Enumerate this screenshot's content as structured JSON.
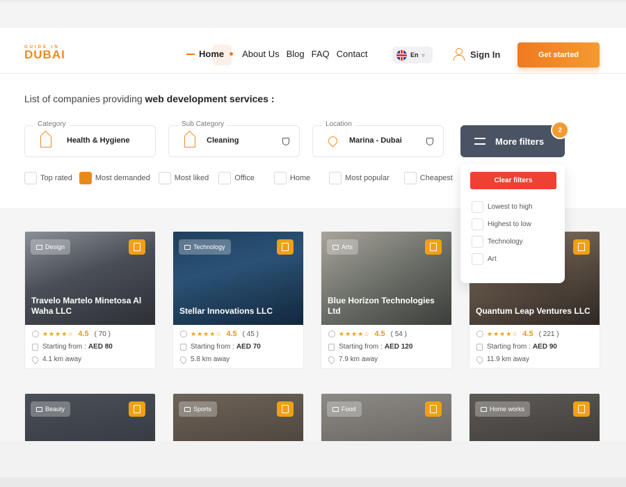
{
  "logo": {
    "small": "GUIDE IN",
    "big": "DUBAI"
  },
  "nav": {
    "home": "Home",
    "about": "About Us",
    "blog": "Blog",
    "faq": "FAQ",
    "contact": "Contact"
  },
  "lang": {
    "code": "En"
  },
  "auth": {
    "sign_in": "Sign In",
    "get_started": "Get started"
  },
  "heading": {
    "prefix": "List of companies providing",
    "service": "web development services :"
  },
  "filters": {
    "category": {
      "label": "Category",
      "value": "Health & Hygiene"
    },
    "sub_category": {
      "label": "Sub Category",
      "value": "Cleaning"
    },
    "location": {
      "label": "Location",
      "value": "Marina - Dubai"
    },
    "more_filters": "More filters",
    "badge_count": "2"
  },
  "checks": [
    {
      "label": "Top rated",
      "checked": false
    },
    {
      "label": "Most demanded",
      "checked": true
    },
    {
      "label": "Most liked",
      "checked": false
    },
    {
      "label": "Office",
      "checked": false
    },
    {
      "label": "Home",
      "checked": false
    },
    {
      "label": "Most popular",
      "checked": false
    },
    {
      "label": "Cheapest",
      "checked": false
    }
  ],
  "dropdown": {
    "clear": "Clear filters",
    "options": [
      "Lowest to high",
      "Highest to low",
      "Technology",
      "Art"
    ]
  },
  "starting_label": "Starting from :",
  "cards": [
    {
      "tag": "Design",
      "title": "Travelo Martelo Minetosa Al Waha LLC",
      "stars": "★★★★☆",
      "rating": "4.5",
      "reviews": "( 70 )",
      "price": "AED 80",
      "distance": "4.1 km away"
    },
    {
      "tag": "Technology",
      "title": "Stellar Innovations LLC",
      "stars": "★★★★☆",
      "rating": "4.5",
      "reviews": "( 45 )",
      "price": "AED 70",
      "distance": "5.8 km away"
    },
    {
      "tag": "Arts",
      "title": "Blue Horizon Technologies Ltd",
      "stars": "★★★★☆",
      "rating": "4.5",
      "reviews": "( 54 )",
      "price": "AED 120",
      "distance": "7.9 km away"
    },
    {
      "tag": "",
      "title": "Quantum Leap Ventures LLC",
      "stars": "★★★★☆",
      "rating": "4.5",
      "reviews": "( 221 )",
      "price": "AED 90",
      "distance": "11.9 km away"
    }
  ],
  "cards_row2": [
    {
      "tag": "Beauty"
    },
    {
      "tag": "Sports"
    },
    {
      "tag": "Food"
    },
    {
      "tag": "Home works"
    }
  ],
  "colors": {
    "accent": "#f07a20",
    "dark": "#4a5363",
    "red": "#ef4034",
    "star": "#f0a014"
  }
}
